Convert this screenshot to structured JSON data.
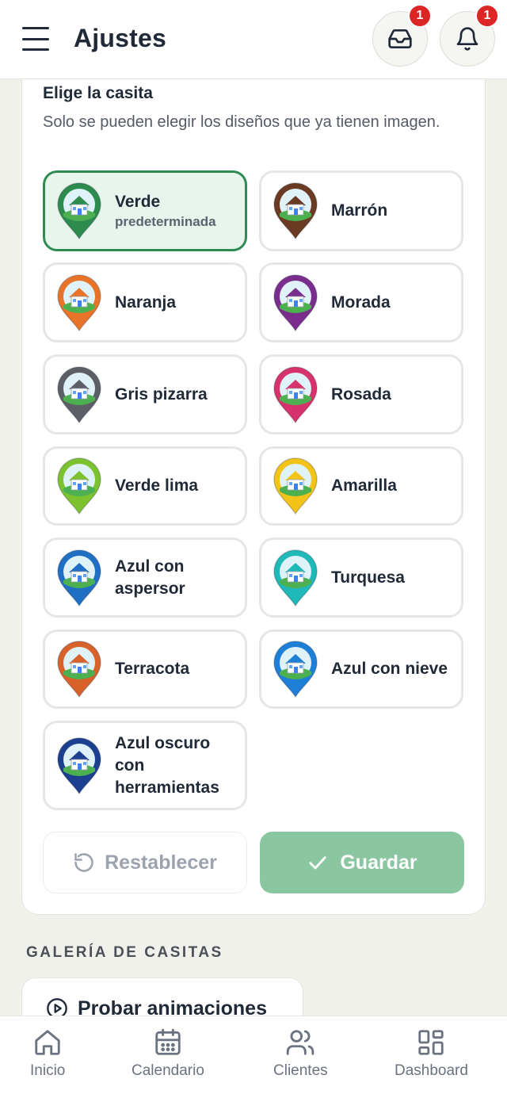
{
  "header": {
    "title": "Ajustes",
    "inbox_badge": "1",
    "bell_badge": "1"
  },
  "house_picker": {
    "title": "Elige la casita",
    "description": "Solo se pueden elegir los diseños que ya tienen imagen.",
    "options": [
      {
        "label": "Verde",
        "sub": "predeterminada",
        "color": "#2e8b4e",
        "selected": true
      },
      {
        "label": "Marrón",
        "color": "#6b3a22"
      },
      {
        "label": "Naranja",
        "color": "#e8742a"
      },
      {
        "label": "Morada",
        "color": "#7b2d8e"
      },
      {
        "label": "Gris pizarra",
        "color": "#5c5f66"
      },
      {
        "label": "Rosada",
        "color": "#d6336c"
      },
      {
        "label": "Verde lima",
        "color": "#7cc22e"
      },
      {
        "label": "Amarilla",
        "color": "#f2c318"
      },
      {
        "label": "Azul con aspersor",
        "color": "#1f6fc4"
      },
      {
        "label": "Turquesa",
        "color": "#1fb9b9"
      },
      {
        "label": "Terracota",
        "color": "#d9622b"
      },
      {
        "label": "Azul con nieve",
        "color": "#1e7fd6"
      },
      {
        "label": "Azul oscuro con herramientas",
        "color": "#1d3f8f"
      }
    ],
    "reset_label": "Restablecer",
    "save_label": "Guardar"
  },
  "gallery": {
    "title": "GALERÍA DE CASITAS",
    "animations_button": "Probar animaciones"
  },
  "bottom_nav": {
    "items": [
      {
        "label": "Inicio",
        "icon": "home-icon"
      },
      {
        "label": "Calendario",
        "icon": "calendar-icon"
      },
      {
        "label": "Clientes",
        "icon": "users-icon"
      },
      {
        "label": "Dashboard",
        "icon": "dashboard-icon"
      }
    ]
  },
  "colors": {
    "accent": "#2e8b52",
    "save_button": "#8ac7a0",
    "badge": "#dc2626"
  }
}
